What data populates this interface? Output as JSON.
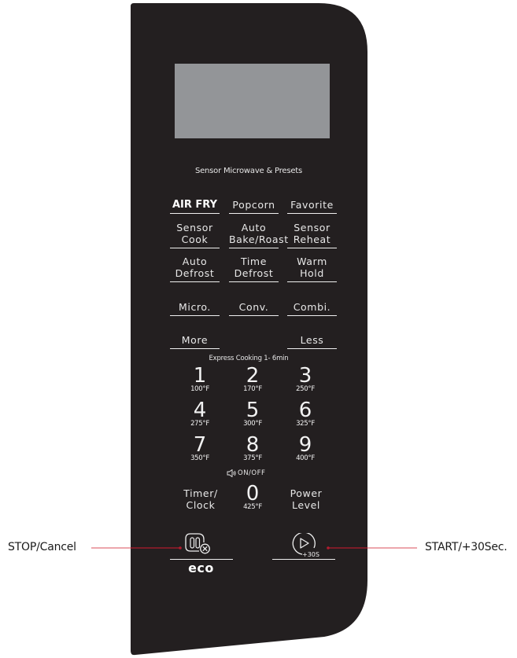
{
  "panel": {
    "colors": {
      "panel": "#231f20",
      "display": "#939598",
      "text": "#e8e8e8",
      "callout_inner": "#b01c2e",
      "callout_outer": "#e0707a"
    },
    "section_title": "Sensor Microwave & Presets",
    "preset_rows": [
      [
        {
          "lines": [
            "AIR FRY"
          ],
          "bold": true
        },
        {
          "lines": [
            "Popcorn"
          ]
        },
        {
          "lines": [
            "Favorite"
          ]
        }
      ],
      [
        {
          "lines": [
            "Sensor",
            "Cook"
          ]
        },
        {
          "lines": [
            "Auto",
            "Bake/Roast"
          ]
        },
        {
          "lines": [
            "Sensor",
            "Reheat"
          ]
        }
      ],
      [
        {
          "lines": [
            "Auto",
            "Defrost"
          ]
        },
        {
          "lines": [
            "Time",
            "Defrost"
          ]
        },
        {
          "lines": [
            "Warm",
            "Hold"
          ]
        }
      ],
      [
        {
          "lines": [
            "Micro."
          ]
        },
        {
          "lines": [
            "Conv."
          ]
        },
        {
          "lines": [
            "Combi."
          ]
        }
      ]
    ],
    "more_label": "More",
    "less_label": "Less",
    "express_label": "Express Cooking 1- 6min",
    "number_keys": [
      {
        "digit": "1",
        "temp": "100°F"
      },
      {
        "digit": "2",
        "temp": "170°F"
      },
      {
        "digit": "3",
        "temp": "250°F"
      },
      {
        "digit": "4",
        "temp": "275°F"
      },
      {
        "digit": "5",
        "temp": "300°F"
      },
      {
        "digit": "6",
        "temp": "325°F"
      },
      {
        "digit": "7",
        "temp": "350°F"
      },
      {
        "digit": "8",
        "temp": "375°F"
      },
      {
        "digit": "9",
        "temp": "400°F"
      },
      {
        "digit": "0",
        "temp": "425°F"
      }
    ],
    "sound_label": "ON/OFF",
    "timer_clock": [
      "Timer/",
      "Clock"
    ],
    "power_level": [
      "Power",
      "Level"
    ],
    "start_badge": "+30S",
    "eco_label": "eco"
  },
  "callouts": {
    "stop": "STOP/Cancel",
    "start": "START/+30Sec."
  }
}
